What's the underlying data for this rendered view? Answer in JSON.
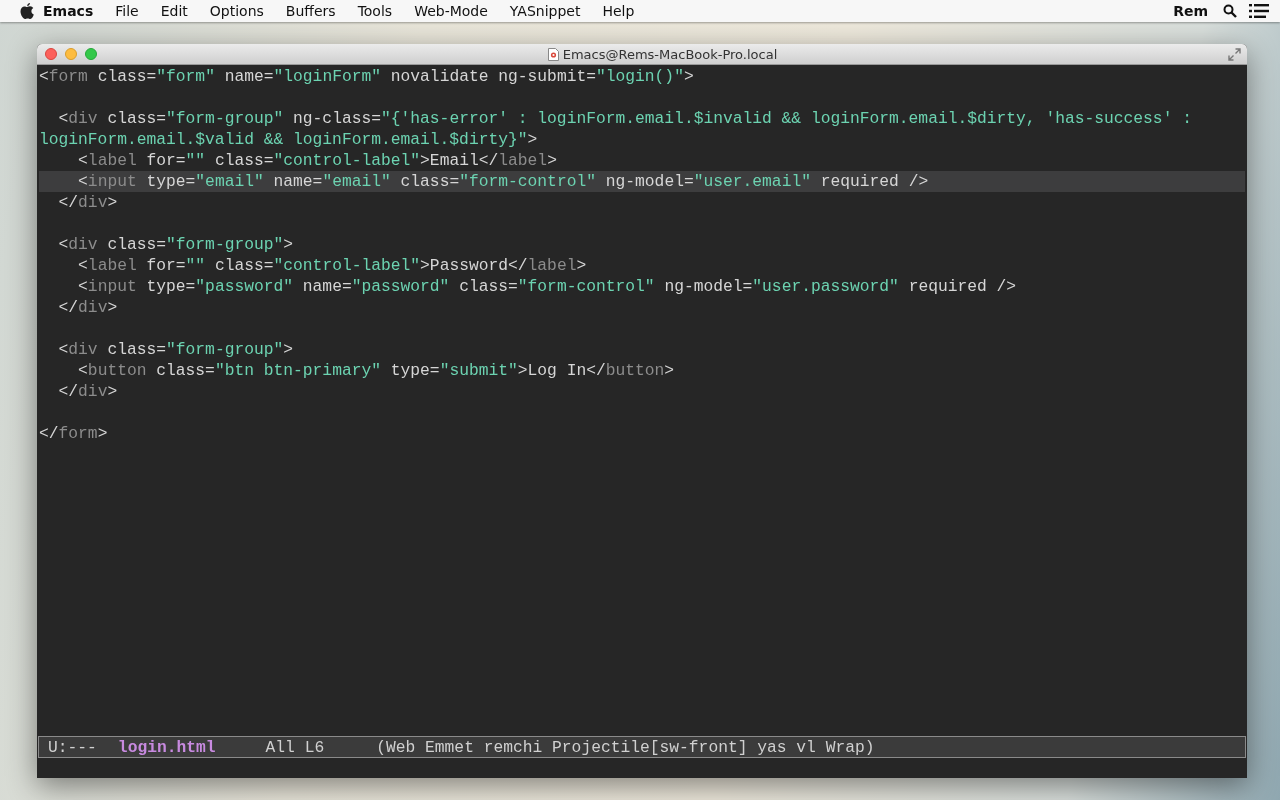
{
  "menu_bar": {
    "app": "Emacs",
    "items": [
      "File",
      "Edit",
      "Options",
      "Buffers",
      "Tools",
      "Web-Mode",
      "YASnippet",
      "Help"
    ],
    "user": "Rem"
  },
  "window": {
    "title": "Emacs@Rems-MacBook-Pro.local"
  },
  "editor": {
    "rows": [
      {
        "kind": "code",
        "current": false,
        "tokens": [
          {
            "kind": "plain",
            "text": "<"
          },
          {
            "kind": "tag",
            "text": "form"
          },
          {
            "kind": "plain",
            "text": " class="
          },
          {
            "kind": "string",
            "text": "\"form\""
          },
          {
            "kind": "plain",
            "text": " name="
          },
          {
            "kind": "string",
            "text": "\"loginForm\""
          },
          {
            "kind": "plain",
            "text": " novalidate ng-submit="
          },
          {
            "kind": "string",
            "text": "\"login()\""
          },
          {
            "kind": "plain",
            "text": ">"
          }
        ]
      },
      {
        "kind": "blank"
      },
      {
        "kind": "code",
        "current": false,
        "tokens": [
          {
            "kind": "plain",
            "text": "  <"
          },
          {
            "kind": "tag",
            "text": "div"
          },
          {
            "kind": "plain",
            "text": " class="
          },
          {
            "kind": "string",
            "text": "\"form-group\""
          },
          {
            "kind": "plain",
            "text": " ng-class="
          },
          {
            "kind": "string",
            "text": "\"{'has-error' : loginForm.email.$invalid && loginForm.email.$dirty, 'has-success' :"
          }
        ]
      },
      {
        "kind": "code",
        "current": false,
        "tokens": [
          {
            "kind": "string",
            "text": "loginForm.email.$valid && loginForm.email.$dirty}\""
          },
          {
            "kind": "plain",
            "text": ">"
          }
        ]
      },
      {
        "kind": "code",
        "current": false,
        "tokens": [
          {
            "kind": "plain",
            "text": "    <"
          },
          {
            "kind": "tag",
            "text": "label"
          },
          {
            "kind": "plain",
            "text": " for="
          },
          {
            "kind": "string",
            "text": "\"\""
          },
          {
            "kind": "plain",
            "text": " class="
          },
          {
            "kind": "string",
            "text": "\"control-label\""
          },
          {
            "kind": "plain",
            "text": ">Email</"
          },
          {
            "kind": "tag",
            "text": "label"
          },
          {
            "kind": "plain",
            "text": ">"
          }
        ]
      },
      {
        "kind": "code",
        "current": true,
        "tokens": [
          {
            "kind": "plain",
            "text": "    <"
          },
          {
            "kind": "tag",
            "text": "input"
          },
          {
            "kind": "plain",
            "text": " type="
          },
          {
            "kind": "string",
            "text": "\"email\""
          },
          {
            "kind": "plain",
            "text": " name="
          },
          {
            "kind": "string",
            "text": "\"email\""
          },
          {
            "kind": "plain",
            "text": " class="
          },
          {
            "kind": "string",
            "text": "\"form-control\""
          },
          {
            "kind": "plain",
            "text": " ng-model="
          },
          {
            "kind": "string",
            "text": "\"user.email\""
          },
          {
            "kind": "plain",
            "text": " required />"
          }
        ]
      },
      {
        "kind": "code",
        "current": false,
        "tokens": [
          {
            "kind": "plain",
            "text": "  </"
          },
          {
            "kind": "tag",
            "text": "div"
          },
          {
            "kind": "plain",
            "text": ">"
          }
        ]
      },
      {
        "kind": "blank"
      },
      {
        "kind": "code",
        "current": false,
        "tokens": [
          {
            "kind": "plain",
            "text": "  <"
          },
          {
            "kind": "tag",
            "text": "div"
          },
          {
            "kind": "plain",
            "text": " class="
          },
          {
            "kind": "string",
            "text": "\"form-group\""
          },
          {
            "kind": "plain",
            "text": ">"
          }
        ]
      },
      {
        "kind": "code",
        "current": false,
        "tokens": [
          {
            "kind": "plain",
            "text": "    <"
          },
          {
            "kind": "tag",
            "text": "label"
          },
          {
            "kind": "plain",
            "text": " for="
          },
          {
            "kind": "string",
            "text": "\"\""
          },
          {
            "kind": "plain",
            "text": " class="
          },
          {
            "kind": "string",
            "text": "\"control-label\""
          },
          {
            "kind": "plain",
            "text": ">Password</"
          },
          {
            "kind": "tag",
            "text": "label"
          },
          {
            "kind": "plain",
            "text": ">"
          }
        ]
      },
      {
        "kind": "code",
        "current": false,
        "tokens": [
          {
            "kind": "plain",
            "text": "    <"
          },
          {
            "kind": "tag",
            "text": "input"
          },
          {
            "kind": "plain",
            "text": " type="
          },
          {
            "kind": "string",
            "text": "\"password\""
          },
          {
            "kind": "plain",
            "text": " name="
          },
          {
            "kind": "string",
            "text": "\"password\""
          },
          {
            "kind": "plain",
            "text": " class="
          },
          {
            "kind": "string",
            "text": "\"form-control\""
          },
          {
            "kind": "plain",
            "text": " ng-model="
          },
          {
            "kind": "string",
            "text": "\"user.password\""
          },
          {
            "kind": "plain",
            "text": " required />"
          }
        ]
      },
      {
        "kind": "code",
        "current": false,
        "tokens": [
          {
            "kind": "plain",
            "text": "  </"
          },
          {
            "kind": "tag",
            "text": "div"
          },
          {
            "kind": "plain",
            "text": ">"
          }
        ]
      },
      {
        "kind": "blank"
      },
      {
        "kind": "code",
        "current": false,
        "tokens": [
          {
            "kind": "plain",
            "text": "  <"
          },
          {
            "kind": "tag",
            "text": "div"
          },
          {
            "kind": "plain",
            "text": " class="
          },
          {
            "kind": "string",
            "text": "\"form-group\""
          },
          {
            "kind": "plain",
            "text": ">"
          }
        ]
      },
      {
        "kind": "code",
        "current": false,
        "tokens": [
          {
            "kind": "plain",
            "text": "    <"
          },
          {
            "kind": "tag",
            "text": "button"
          },
          {
            "kind": "plain",
            "text": " class="
          },
          {
            "kind": "string",
            "text": "\"btn btn-primary\""
          },
          {
            "kind": "plain",
            "text": " type="
          },
          {
            "kind": "string",
            "text": "\"submit\""
          },
          {
            "kind": "plain",
            "text": ">Log In</"
          },
          {
            "kind": "tag",
            "text": "button"
          },
          {
            "kind": "plain",
            "text": ">"
          }
        ]
      },
      {
        "kind": "code",
        "current": false,
        "tokens": [
          {
            "kind": "plain",
            "text": "  </"
          },
          {
            "kind": "tag",
            "text": "div"
          },
          {
            "kind": "plain",
            "text": ">"
          }
        ]
      },
      {
        "kind": "blank"
      },
      {
        "kind": "code",
        "current": false,
        "tokens": [
          {
            "kind": "plain",
            "text": "</"
          },
          {
            "kind": "tag",
            "text": "form"
          },
          {
            "kind": "plain",
            "text": ">"
          }
        ]
      }
    ]
  },
  "mode_line": {
    "status": "U:---",
    "buffer": "login.html",
    "position": "All L6",
    "modes": "(Web Emmet remchi Projectile[sw-front] yas vl Wrap)"
  }
}
